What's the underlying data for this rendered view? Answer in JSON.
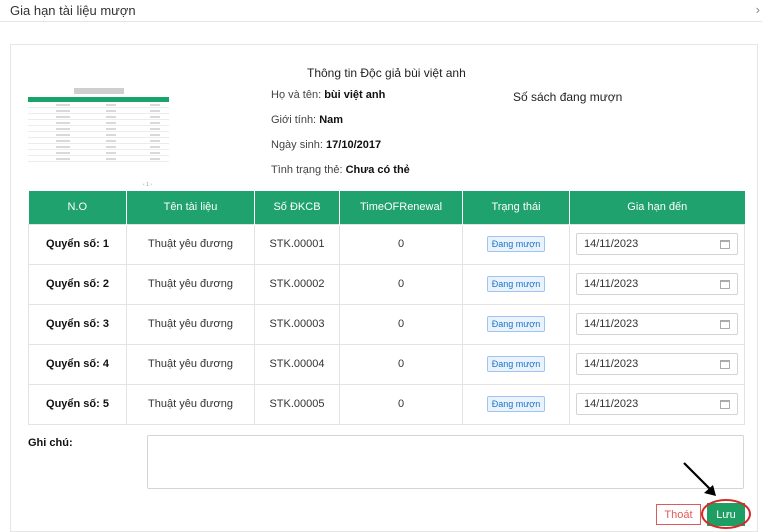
{
  "modal": {
    "title": "Gia hạn tài liệu mượn",
    "close": "›"
  },
  "reader": {
    "title": "Thông tin Độc giả bùi việt anh",
    "fields": [
      {
        "label": "Họ và tên:",
        "value": "bùi việt anh"
      },
      {
        "label": "Giới tính:",
        "value": "Nam"
      },
      {
        "label": "Ngày sinh:",
        "value": "17/10/2017"
      },
      {
        "label": "Tình trạng thẻ:",
        "value": "Chưa có thẻ"
      }
    ],
    "books_label": "Số sách đang mượn"
  },
  "table": {
    "headers": [
      "N.O",
      "Tên tài liệu",
      "Số ĐKCB",
      "TimeOFRenewal",
      "Trạng thái",
      "Gia hạn đến"
    ],
    "rows": [
      {
        "no": "Quyển số: 1",
        "name": "Thuật yêu đương",
        "code": "STK.00001",
        "renewals": "0",
        "status": "Đang mượn",
        "date": "14/11/2023"
      },
      {
        "no": "Quyển số: 2",
        "name": "Thuật yêu đương",
        "code": "STK.00002",
        "renewals": "0",
        "status": "Đang mượn",
        "date": "14/11/2023"
      },
      {
        "no": "Quyển số: 3",
        "name": "Thuật yêu đương",
        "code": "STK.00003",
        "renewals": "0",
        "status": "Đang mượn",
        "date": "14/11/2023"
      },
      {
        "no": "Quyển số: 4",
        "name": "Thuật yêu đương",
        "code": "STK.00004",
        "renewals": "0",
        "status": "Đang mượn",
        "date": "14/11/2023"
      },
      {
        "no": "Quyển số: 5",
        "name": "Thuật yêu đương",
        "code": "STK.00005",
        "renewals": "0",
        "status": "Đang mượn",
        "date": "14/11/2023"
      }
    ]
  },
  "note": {
    "label": "Ghi chú:",
    "value": ""
  },
  "buttons": {
    "exit": "Thoát",
    "save": "Lưu"
  },
  "colors": {
    "accent": "#20a26f",
    "danger": "#e05a5a",
    "highlight": "#d62a2a"
  }
}
